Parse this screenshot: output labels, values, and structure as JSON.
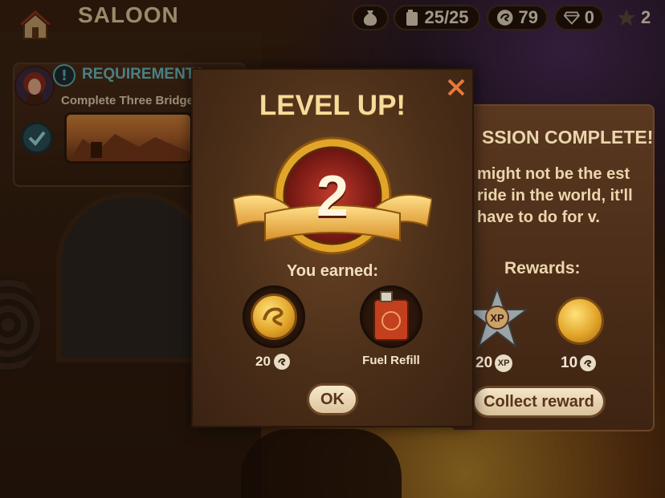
{
  "header": {
    "title": "SALOON",
    "currencies": [
      {
        "icon": "money-bag-icon",
        "value": ""
      },
      {
        "icon": "fuel-can-icon",
        "value": "25/25"
      },
      {
        "icon": "coin-icon",
        "value": "79"
      },
      {
        "icon": "diamond-icon",
        "value": "0"
      }
    ],
    "stars": "2"
  },
  "requirements": {
    "title": "REQUIREMENTS",
    "description": "Complete Three Bridges",
    "completed": true
  },
  "mission": {
    "title": "SSION COMPLETE!",
    "text": "might not be the est ride in the world, it'll have to do for v.",
    "rewards_label": "Rewards:",
    "xp_reward": "20",
    "xp_chip": "XP",
    "star_badge": "XP",
    "coin_reward": "10",
    "collect_label": "Collect reward"
  },
  "levelup": {
    "title": "LEVEL UP!",
    "level": "2",
    "earned_label": "You earned:",
    "coin_reward": "20",
    "fuel_label": "Fuel Refill",
    "ok_label": "OK"
  },
  "colors": {
    "accent_teal": "#6cc2c8",
    "gold": "#f6dc9a",
    "text_cream": "#ecd6ad"
  }
}
